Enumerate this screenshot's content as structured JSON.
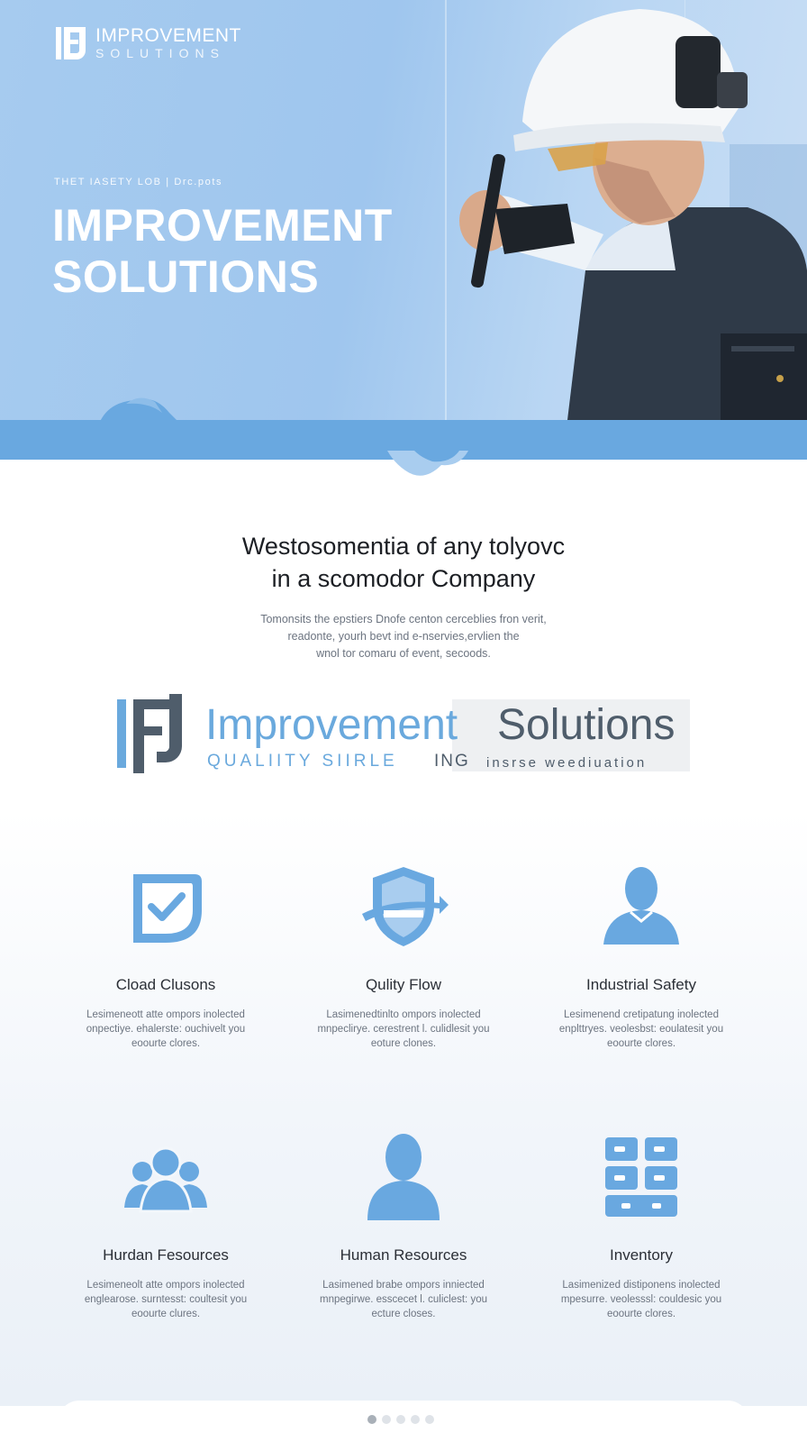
{
  "brand": {
    "name": "IMPROVEMENT",
    "sub": "SOLUTIONS",
    "mark_icon": "fj-monogram-icon"
  },
  "hero": {
    "eyebrow": "THET IASETY LOB  |  Drc.pots",
    "title_line1": "IMPROVEMENT",
    "title_line2": "SOLUTIONS",
    "image_icon": "technician-in-hardhat-photo"
  },
  "intro": {
    "heading_line1": "Westosomentia of any tolyovc",
    "heading_line2": "in a scomodor Company",
    "body_line1": "Tomonsits the epstiers Dnofe centon cerceblies fron verit,",
    "body_line2": "readonte, yourh bevt ind e-nservies,ervlien the",
    "body_line3": "wnol tor comaru of event, secoods."
  },
  "logo_block": {
    "word1": "Improvement",
    "word2": "Solutions",
    "tag1": "QUALIITY SIIRLE",
    "tag2": "ING",
    "tag3": "insrse weediuation"
  },
  "features": [
    {
      "icon": "checkmark-badge-icon",
      "title": "Cload Clusons",
      "desc": [
        "Lesimeneott atte ompors inolected",
        "onpectiye. ehalerste: ouchivelt you",
        "eoourte clores."
      ]
    },
    {
      "icon": "shield-flow-icon",
      "title": "Qulity Flow",
      "desc": [
        "Lasimenedtinlto ompors inolected",
        "mnpeclirye. cerestrent l. culidlesit you",
        "eoture clones."
      ]
    },
    {
      "icon": "person-icon",
      "title": "Industrial Safety",
      "desc": [
        "Lesimenend cretipatung inolected",
        "enplttryes. veolesbst: eoulatesit you",
        "eoourte clores."
      ]
    },
    {
      "icon": "group-icon",
      "title": "Hurdan Fesources",
      "desc": [
        "Lesimeneolt atte ompors inolected",
        "englearose. surntesst: coultesit you",
        "eoourte clures."
      ]
    },
    {
      "icon": "person-bust-icon",
      "title": "Human Resources",
      "desc": [
        "Lasimened brabe ompors inniected",
        "mnpegirwe. esscecet l. culiclest: you",
        "ecture closes."
      ]
    },
    {
      "icon": "grid-inventory-icon",
      "title": "Inventory",
      "desc": [
        "Lasimenized distiponens inolected",
        "mpesurre. veolesssl: couldesic you",
        "eoourte clores."
      ]
    }
  ],
  "carousel": {
    "pages": 5,
    "active": 1
  },
  "colors": {
    "accent": "#69a8e0",
    "dark": "#4f5d6b",
    "hero": "#a6cbef"
  }
}
